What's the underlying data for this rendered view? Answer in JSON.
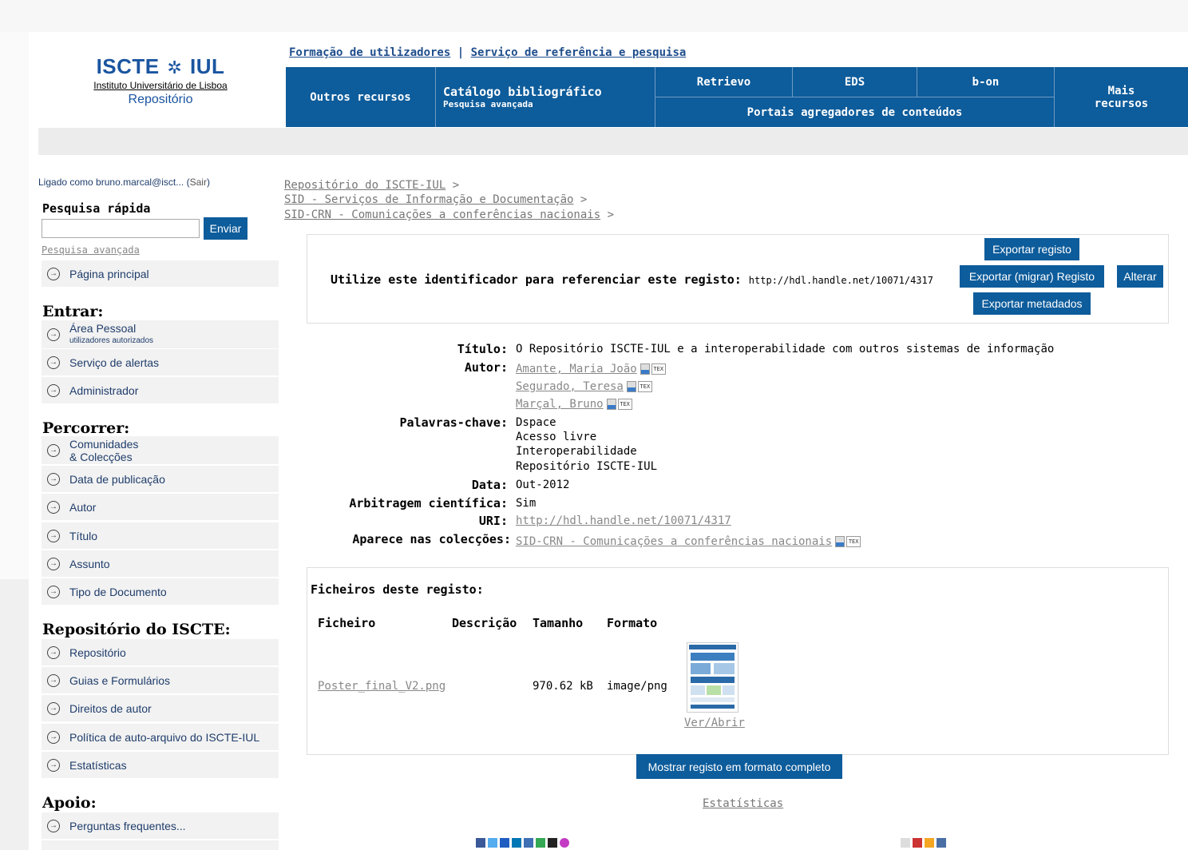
{
  "header": {
    "logo_title_left": "ISCTE",
    "logo_symbol": "✲",
    "logo_title_right": "IUL",
    "logo_subtitle": "Instituto Universitário de Lisboa",
    "logo_repo": "Repositório",
    "toplink_1": "Formação de utilizadores",
    "toplink_sep": "|",
    "toplink_2": "Serviço de referência e pesquisa"
  },
  "nav": {
    "outros": "Outros recursos",
    "catalogo": "Catálogo bibliográfico",
    "catalogo_sub": "Pesquisa avançada",
    "retrieve": "Retrievo",
    "eds": "EDS",
    "bon": "b-on",
    "portais": "Portais agregadores de conteúdos",
    "mais_1": "Mais",
    "mais_2": "recursos"
  },
  "sidebar": {
    "logged_prefix": "Ligado como bruno.marcal@isct...",
    "logout": "Sair",
    "quick_search": "Pesquisa rápida",
    "search_value": "",
    "search_button": "Enviar",
    "advanced": "Pesquisa avançada",
    "home": "Página principal",
    "enter_head": "Entrar:",
    "area_pessoal": "Área Pessoal",
    "area_pessoal_sub": "utilizadores autorizados",
    "alertas": "Serviço de alertas",
    "admin": "Administrador",
    "browse_head": "Percorrer:",
    "comunidades_1": "Comunidades",
    "comunidades_2": "& Colecções",
    "data_pub": "Data de publicação",
    "autor": "Autor",
    "titulo": "Título",
    "assunto": "Assunto",
    "tipo_doc": "Tipo de Documento",
    "repo_head": "Repositório do ISCTE:",
    "repositorio": "Repositório",
    "guias": "Guias e Formulários",
    "direitos": "Direitos de autor",
    "politica": "Política de auto-arquivo do ISCTE-IUL",
    "estatisticas": "Estatísticas",
    "apoio_head": "Apoio:",
    "perguntas": "Perguntas frequentes..."
  },
  "breadcrumb": {
    "c1": "Repositório do ISCTE-IUL",
    "c2": "SID - Serviços de Informação e Documentação",
    "c3": "SID-CRN - Comunicações a conferências nacionais",
    "sep": ">"
  },
  "identifier": {
    "label": "Utilize este identificador para referenciar este registo:",
    "url": "http://hdl.handle.net/10071/4317",
    "btn_export": "Exportar registo",
    "btn_migrar": "Exportar (migrar) Registo",
    "btn_alterar": "Alterar",
    "btn_meta": "Exportar metadados"
  },
  "record": {
    "titulo_label": "Título:",
    "titulo": "O Repositório ISCTE-IUL e a interoperabilidade com outros sistemas de informação",
    "autor_label": "Autor:",
    "autor1": "Amante, Maria João",
    "autor2": "Segurado, Teresa",
    "autor3": "Marçal, Bruno",
    "palavras_label": "Palavras-chave:",
    "kw1": "Dspace",
    "kw2": "Acesso livre",
    "kw3": "Interoperabilidade",
    "kw4": "Repositório ISCTE-IUL",
    "data_label": "Data:",
    "data": "Out-2012",
    "arbitragem_label": "Arbitragem científica:",
    "arbitragem": "Sim",
    "uri_label": "URI:",
    "uri": "http://hdl.handle.net/10071/4317",
    "colecoes_label": "Aparece nas colecções:",
    "colecao": "SID-CRN - Comunicações a conferências nacionais",
    "icon_label": "TEX"
  },
  "files": {
    "title": "Ficheiros deste registo:",
    "h_ficheiro": "Ficheiro",
    "h_descricao": "Descrição",
    "h_tamanho": "Tamanho",
    "h_formato": "Formato",
    "name": "Poster_final_V2.png",
    "size": "970.62 kB",
    "format": "image/png",
    "open": "Ver/Abrir"
  },
  "footer": {
    "full_record": "Mostrar registo em formato completo",
    "stats": "Estatísticas"
  },
  "colors": {
    "brand_blue": "#0d5c9b"
  }
}
